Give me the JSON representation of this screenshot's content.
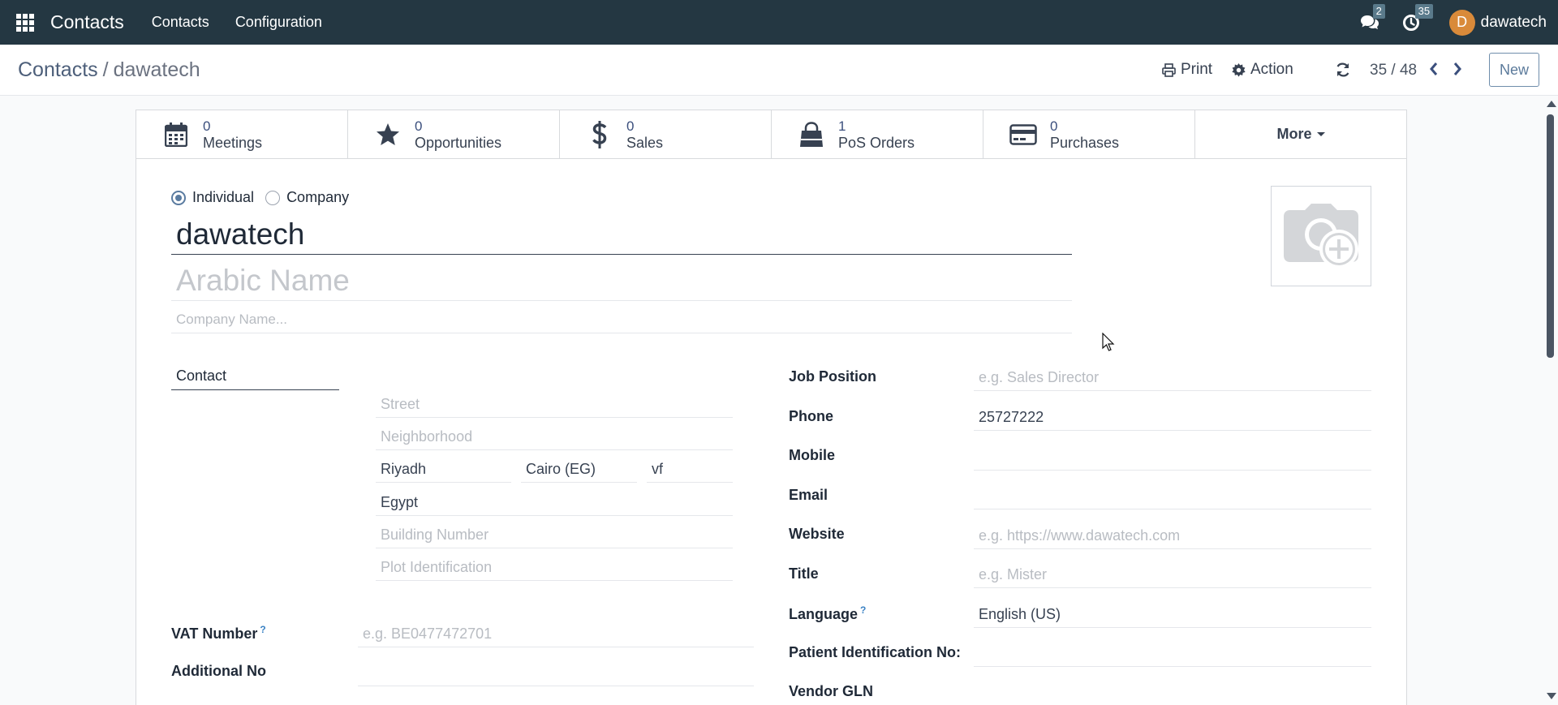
{
  "navbar": {
    "brand": "Contacts",
    "menus": [
      "Contacts",
      "Configuration"
    ],
    "messages_count": "2",
    "activities_count": "35",
    "user_initial": "D",
    "user_name": "dawatech"
  },
  "control_panel": {
    "breadcrumb_parent": "Contacts",
    "breadcrumb_separator": "/",
    "breadcrumb_current": "dawatech",
    "print_label": "Print",
    "action_label": "Action",
    "pager": "35 / 48",
    "new_label": "New"
  },
  "stat_buttons": [
    {
      "value": "0",
      "label": "Meetings",
      "icon": "calendar-icon"
    },
    {
      "value": "0",
      "label": "Opportunities",
      "icon": "star-icon"
    },
    {
      "value": "0",
      "label": "Sales",
      "icon": "dollar-icon"
    },
    {
      "value": "1",
      "label": "PoS Orders",
      "icon": "shopping-bag-icon"
    },
    {
      "value": "0",
      "label": "Purchases",
      "icon": "credit-card-icon"
    }
  ],
  "more_label": "More",
  "company_type": {
    "individual_label": "Individual",
    "company_label": "Company",
    "selected": "Individual"
  },
  "form": {
    "name": "dawatech",
    "arabic_name_placeholder": "Arabic Name",
    "company_name_placeholder": "Company Name...",
    "address_type": "Contact",
    "street_placeholder": "Street",
    "neighborhood_placeholder": "Neighborhood",
    "city": "Riyadh",
    "state": "Cairo (EG)",
    "zip": "vf",
    "country": "Egypt",
    "building_number_placeholder": "Building Number",
    "plot_identification_placeholder": "Plot Identification",
    "vat_label": "VAT Number",
    "vat_help": "?",
    "vat_placeholder": "e.g. BE0477472701",
    "additional_no_label": "Additional No",
    "additional_no_value": "",
    "job_position_label": "Job Position",
    "job_position_placeholder": "e.g. Sales Director",
    "phone_label": "Phone",
    "phone_value": "25727222",
    "mobile_label": "Mobile",
    "mobile_value": "",
    "email_label": "Email",
    "email_value": "",
    "website_label": "Website",
    "website_placeholder": "e.g. https://www.dawatech.com",
    "title_label": "Title",
    "title_placeholder": "e.g. Mister",
    "language_label": "Language",
    "language_help": "?",
    "language_value": "English (US)",
    "patient_id_label": "Patient Identification No:",
    "patient_id_value": "",
    "vendor_gln_label": "Vendor GLN"
  }
}
